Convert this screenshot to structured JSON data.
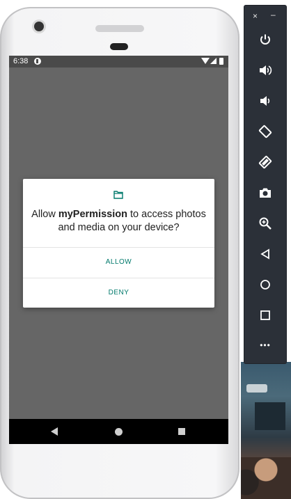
{
  "status_bar": {
    "time": "6:38",
    "app_badge_icon": "p-circle-icon"
  },
  "dialog": {
    "icon": "folder-icon",
    "message_before": "Allow ",
    "app_name": "myPermission",
    "message_after": " to access photos and media on your device?",
    "buttons": {
      "allow": "ALLOW",
      "deny": "DENY"
    },
    "accent_color": "#00796b"
  },
  "nav_bar": {
    "back": "back-icon",
    "home": "home-icon",
    "recents": "recents-icon"
  },
  "emulator_toolbar": {
    "close": "×",
    "minimize": "–",
    "items": [
      "power",
      "volume-up",
      "volume-down",
      "rotate-left",
      "rotate-right",
      "screenshot",
      "zoom",
      "back",
      "home",
      "overview",
      "more"
    ],
    "more_label": "•••"
  }
}
